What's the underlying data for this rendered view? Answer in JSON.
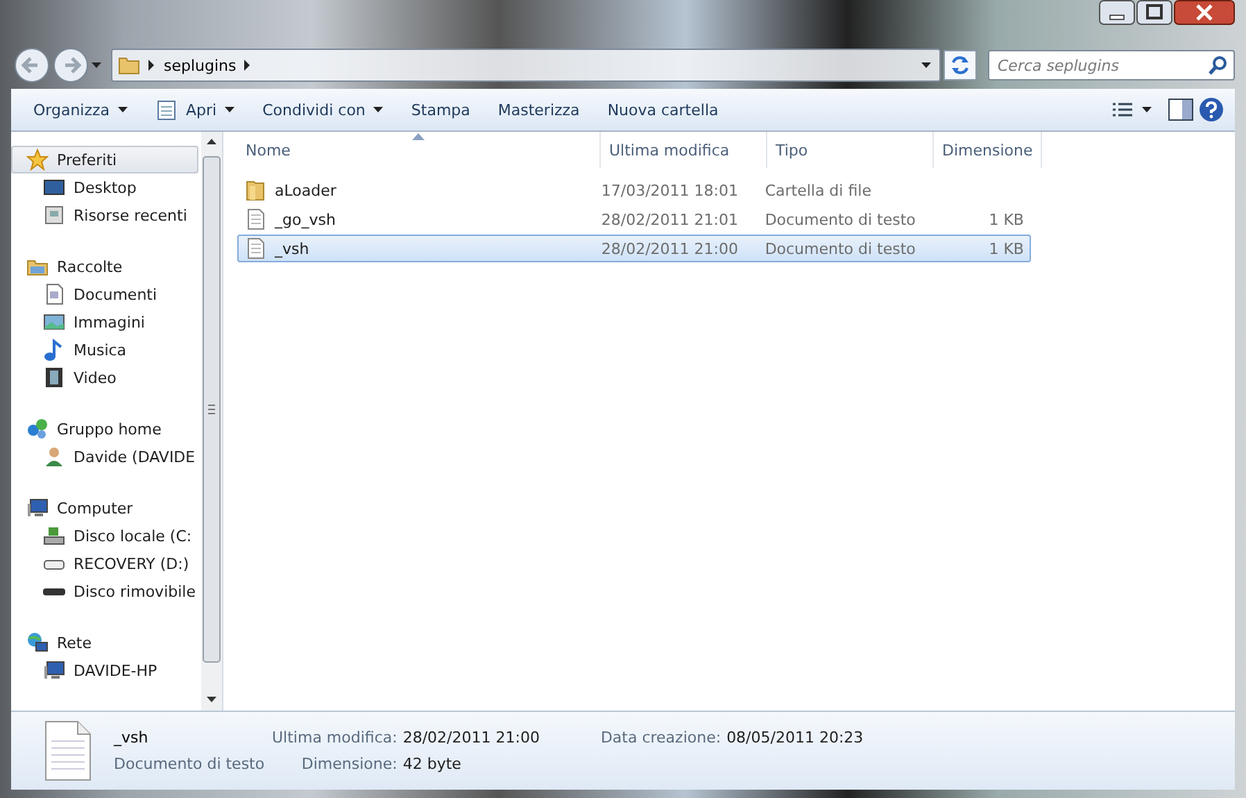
{
  "address": {
    "segments": [
      "seplugins"
    ]
  },
  "search": {
    "placeholder": "Cerca seplugins"
  },
  "toolbar": [
    {
      "label": "Organizza",
      "dropdown": true,
      "kind": "plain"
    },
    {
      "label": "Apri",
      "dropdown": true,
      "kind": "notepad"
    },
    {
      "label": "Condividi con",
      "dropdown": true,
      "kind": "plain"
    },
    {
      "label": "Stampa",
      "dropdown": false,
      "kind": "plain"
    },
    {
      "label": "Masterizza",
      "dropdown": false,
      "kind": "plain"
    },
    {
      "label": "Nuova cartella",
      "dropdown": false,
      "kind": "plain"
    }
  ],
  "sidebar": {
    "groups": [
      {
        "label": "Preferiti",
        "kind": "star",
        "selected": true,
        "children": [
          {
            "label": "Desktop",
            "kind": "desktop"
          },
          {
            "label": "Risorse recenti",
            "kind": "recent"
          }
        ]
      },
      {
        "label": "Raccolte",
        "kind": "library",
        "selected": false,
        "children": [
          {
            "label": "Documenti",
            "kind": "document"
          },
          {
            "label": "Immagini",
            "kind": "image"
          },
          {
            "label": "Musica",
            "kind": "music"
          },
          {
            "label": "Video",
            "kind": "video"
          }
        ]
      },
      {
        "label": "Gruppo home",
        "kind": "homegroup",
        "selected": false,
        "children": [
          {
            "label": "Davide (DAVIDE",
            "kind": "user"
          }
        ]
      },
      {
        "label": "Computer",
        "kind": "computer",
        "selected": false,
        "children": [
          {
            "label": "Disco locale (C:",
            "kind": "disk"
          },
          {
            "label": "RECOVERY (D:)",
            "kind": "drive"
          },
          {
            "label": "Disco rimovibile",
            "kind": "removable"
          }
        ]
      },
      {
        "label": "Rete",
        "kind": "network",
        "selected": false,
        "children": [
          {
            "label": "DAVIDE-HP",
            "kind": "computer"
          }
        ]
      }
    ]
  },
  "table": {
    "columns": [
      {
        "label": "Nome",
        "sorted": true
      },
      {
        "label": "Ultima modifica",
        "sorted": false
      },
      {
        "label": "Tipo",
        "sorted": false
      },
      {
        "label": "Dimensione",
        "sorted": false
      }
    ],
    "rows": [
      {
        "kind": "folder",
        "name": "aLoader",
        "modified": "17/03/2011 18:01",
        "type": "Cartella di file",
        "size": "",
        "selected": false
      },
      {
        "kind": "text",
        "name": "_go_vsh",
        "modified": "28/02/2011 21:01",
        "type": "Documento di testo",
        "size": "1 KB",
        "selected": false
      },
      {
        "kind": "text",
        "name": "_vsh",
        "modified": "28/02/2011 21:00",
        "type": "Documento di testo",
        "size": "1 KB",
        "selected": true
      }
    ]
  },
  "details": {
    "name": "_vsh",
    "type": "Documento di testo",
    "fields": [
      {
        "label": "Ultima modifica:",
        "value": "28/02/2011 21:00"
      },
      {
        "label": "Dimensione:",
        "value": "42 byte"
      },
      {
        "label": "Data creazione:",
        "value": "08/05/2011 20:23"
      }
    ]
  }
}
